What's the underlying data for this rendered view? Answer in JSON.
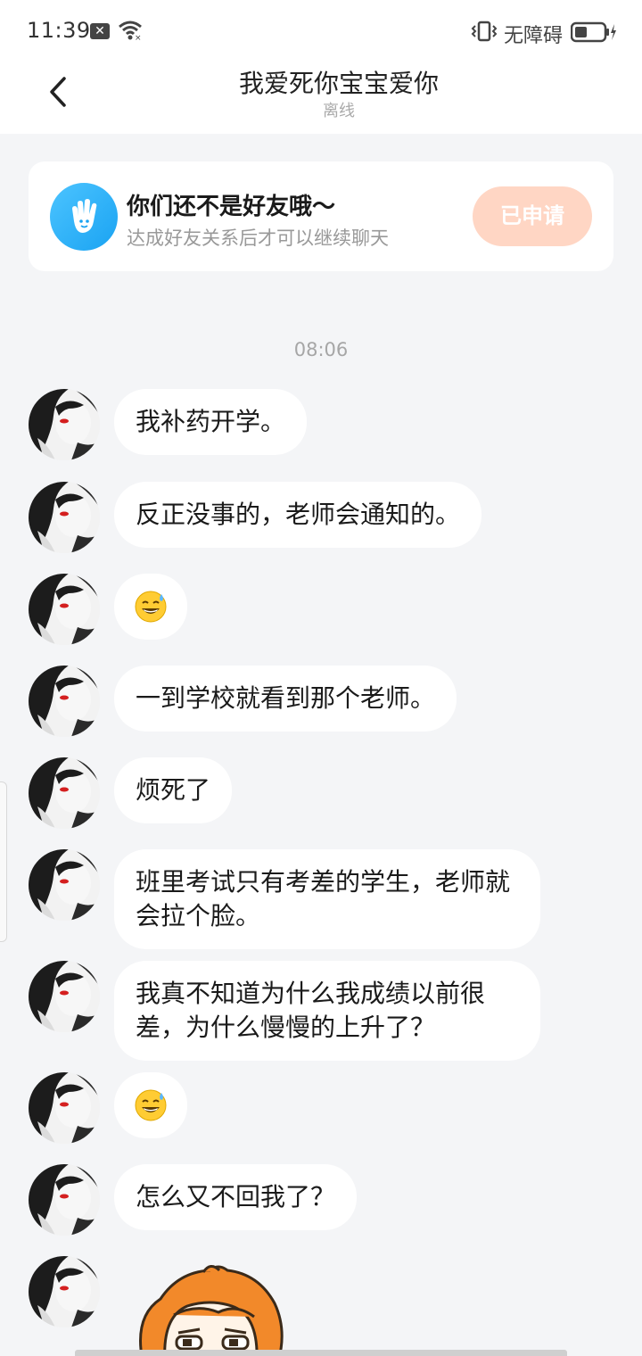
{
  "status_bar": {
    "time": "11:39",
    "accessibility": "无障碍",
    "icons": [
      "notification-x-icon",
      "wifi-icon",
      "vibrate-icon",
      "battery-icon"
    ]
  },
  "header": {
    "title": "我爱死你宝宝爱你",
    "status": "离线",
    "back_icon": "chevron-left-icon"
  },
  "friend_card": {
    "title": "你们还不是好友哦～",
    "subtitle": "达成好友关系后才可以继续聊天",
    "button_label": "已申请",
    "icon": "wave-hand-icon",
    "accent_color": "#1aa3f2",
    "button_color": "#ffd6c4"
  },
  "chat": {
    "timestamp": "08:06",
    "messages": [
      {
        "type": "text",
        "text": "我补药开学。"
      },
      {
        "type": "text",
        "text": "反正没事的，老师会通知的。"
      },
      {
        "type": "emoji",
        "emoji": "sweat-smile-emoji"
      },
      {
        "type": "text",
        "text": "一到学校就看到那个老师。"
      },
      {
        "type": "text",
        "text": "烦死了"
      },
      {
        "type": "text",
        "text": "班里考试只有考差的学生，老师就会拉个脸。"
      },
      {
        "type": "text",
        "text": "我真不知道为什么我成绩以前很差，为什么慢慢的上升了？"
      },
      {
        "type": "emoji",
        "emoji": "sweat-smile-emoji"
      },
      {
        "type": "text",
        "text": "怎么又不回我了？"
      },
      {
        "type": "sticker",
        "sticker": "orange-hair-character-sticker"
      }
    ]
  }
}
